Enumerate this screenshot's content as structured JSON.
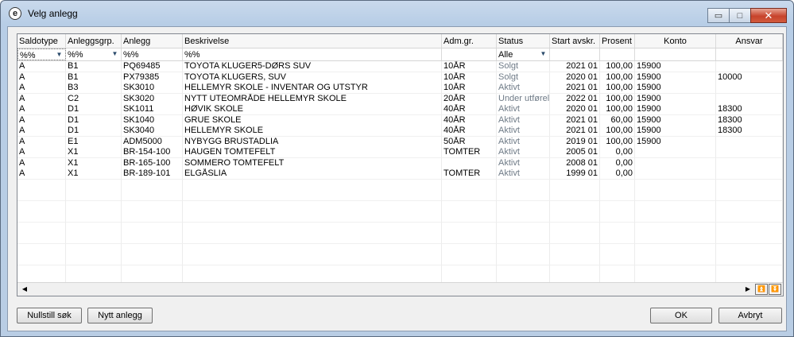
{
  "window": {
    "title": "Velg anlegg",
    "icon_letter": "e"
  },
  "grid": {
    "columns": [
      "Saldotype",
      "Anleggsgrp.",
      "Anlegg",
      "Beskrivelse",
      "Adm.gr.",
      "Status",
      "Start avskr.",
      "Prosent",
      "Konto",
      "Ansvar"
    ],
    "filters": [
      "%%",
      "%%",
      "%%",
      "%%",
      "",
      "Alle",
      "",
      "",
      "",
      ""
    ],
    "rows": [
      [
        "A",
        "B1",
        "PQ69485",
        "TOYOTA KLUGER5-DØRS SUV",
        "10ÅR",
        "Solgt",
        "2021 01",
        "100,00",
        "15900",
        ""
      ],
      [
        "A",
        "B1",
        "PX79385",
        "TOYOTA KLUGERS, SUV",
        "10ÅR",
        "Solgt",
        "2020 01",
        "100,00",
        "15900",
        "10000"
      ],
      [
        "A",
        "B3",
        "SK3010",
        "HELLEMYR SKOLE - INVENTAR OG UTSTYR",
        "10ÅR",
        "Aktivt",
        "2021 01",
        "100,00",
        "15900",
        ""
      ],
      [
        "A",
        "C2",
        "SK3020",
        "NYTT UTEOMRÅDE HELLEMYR SKOLE",
        "20ÅR",
        "Under utførel",
        "2022 01",
        "100,00",
        "15900",
        ""
      ],
      [
        "A",
        "D1",
        "SK1011",
        "HØVIK SKOLE",
        "40ÅR",
        "Aktivt",
        "2020 01",
        "100,00",
        "15900",
        "18300"
      ],
      [
        "A",
        "D1",
        "SK1040",
        "GRUE SKOLE",
        "40ÅR",
        "Aktivt",
        "2021 01",
        "60,00",
        "15900",
        "18300"
      ],
      [
        "A",
        "D1",
        "SK3040",
        "HELLEMYR SKOLE",
        "40ÅR",
        "Aktivt",
        "2021 01",
        "100,00",
        "15900",
        "18300"
      ],
      [
        "A",
        "E1",
        "ADM5000",
        "NYBYGG BRUSTADLIA",
        "50ÅR",
        "Aktivt",
        "2019 01",
        "100,00",
        "15900",
        ""
      ],
      [
        "A",
        "X1",
        "BR-154-100",
        "HAUGEN TOMTEFELT",
        "TOMTER",
        "Aktivt",
        "2005 01",
        "0,00",
        "",
        ""
      ],
      [
        "A",
        "X1",
        "BR-165-100",
        "SOMMERO TOMTEFELT",
        "",
        "Aktivt",
        "2008 01",
        "0,00",
        "",
        ""
      ],
      [
        "A",
        "X1",
        "BR-189-101",
        "ELGÅSLIA",
        "TOMTER",
        "Aktivt",
        "1999 01",
        "0,00",
        "",
        ""
      ]
    ],
    "empty_rows": 10
  },
  "buttons": {
    "reset": "Nullstill søk",
    "new": "Nytt anlegg",
    "ok": "OK",
    "cancel": "Avbryt"
  },
  "icons": {
    "minimize": "▭",
    "maximize": "□",
    "close": "✕",
    "dropdown": "▼",
    "scroll_left": "◀",
    "scroll_right": "▶",
    "nav_up": "⏫",
    "nav_down": "⏬"
  },
  "colors": {
    "selected_row": "#cde4f8",
    "title_bar": "#c9d9ec",
    "close_button": "#c7432b"
  }
}
